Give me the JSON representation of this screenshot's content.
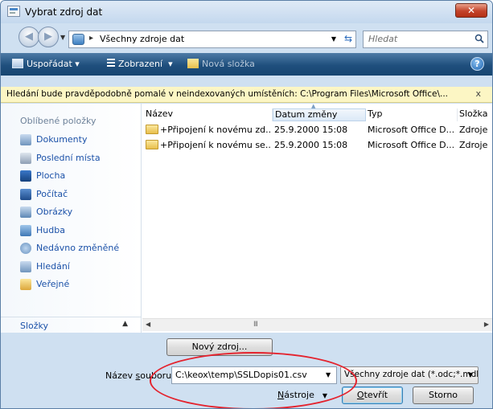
{
  "window": {
    "title": "Vybrat zdroj dat",
    "close_label": "✕"
  },
  "address": {
    "path": "Všechny zdroje dat",
    "separator": "▸"
  },
  "search": {
    "placeholder": "Hledat"
  },
  "toolbar": {
    "organize_label": "Uspořádat",
    "views_label": "Zobrazení",
    "new_folder_label": "Nová složka",
    "help_label": "?"
  },
  "infobar": {
    "text": "Hledání bude pravděpodobně pomalé v neindexovaných umístěních: C:\\Program Files\\Microsoft Office\\...",
    "close_label": "x"
  },
  "navpane": {
    "heading": "Oblíbené položky",
    "items": [
      {
        "label": "Dokumenty",
        "icon": "documents-icon"
      },
      {
        "label": "Poslední místa",
        "icon": "recent-places-icon"
      },
      {
        "label": "Plocha",
        "icon": "desktop-icon"
      },
      {
        "label": "Počítač",
        "icon": "computer-icon"
      },
      {
        "label": "Obrázky",
        "icon": "pictures-icon"
      },
      {
        "label": "Hudba",
        "icon": "music-icon"
      },
      {
        "label": "Nedávno změněné",
        "icon": "recently-changed-icon"
      },
      {
        "label": "Hledání",
        "icon": "searches-icon"
      },
      {
        "label": "Veřejné",
        "icon": "public-icon"
      }
    ],
    "folders_label": "Složky"
  },
  "filelist": {
    "columns": [
      "Název",
      "Datum změny",
      "Typ",
      "Složka"
    ],
    "rows": [
      {
        "name": "+Připojení k novému zd...",
        "date": "25.9.2000 15:08",
        "type": "Microsoft Office D...",
        "folder": "Zdroje"
      },
      {
        "name": "+Připojení k novému se...",
        "date": "25.9.2000 15:08",
        "type": "Microsoft Office D...",
        "folder": "Zdroje"
      }
    ],
    "scroll_grip": "III"
  },
  "bottom": {
    "new_source_label": "Nový zdroj...",
    "filename_label_pre": "Název ",
    "filename_label_u": "s",
    "filename_label_post": "ouboru:",
    "filename_value": "C:\\keox\\temp\\SSLDopis01.csv",
    "filter_value": "Všechny zdroje dat (*.odc;*.mdb",
    "tools_u": "N",
    "tools_rest": "ástroje",
    "open_u": "O",
    "open_rest": "tevřít",
    "cancel_label": "Storno"
  },
  "colors": {
    "toolbar": "#1f4f7d",
    "link": "#1b51a8",
    "infobar": "#fcf6c4",
    "highlight": "#e4232e"
  }
}
